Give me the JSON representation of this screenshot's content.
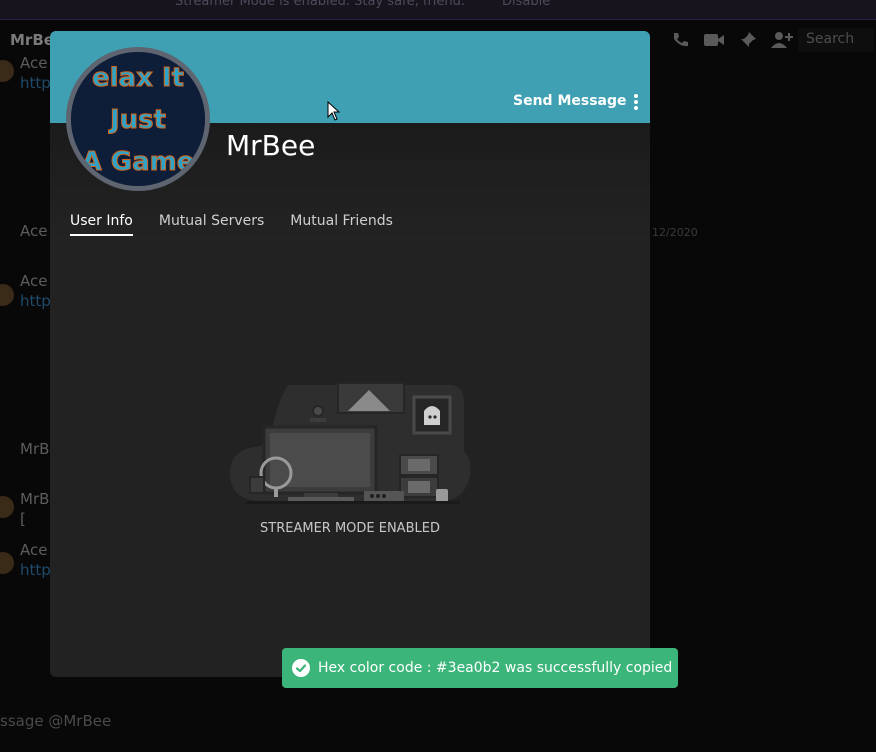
{
  "background": {
    "streamer_notice": "Streamer Mode is enabled. Stay safe, friend.",
    "disable_label": "Disable",
    "channel_name": "MrBe",
    "search_placeholder": "Search",
    "messages": [
      {
        "author": "Ace",
        "text": "http"
      },
      {
        "author": "Ace",
        "text": ""
      },
      {
        "author": "Ace",
        "text": "http"
      },
      {
        "author": "MrB",
        "text": ""
      },
      {
        "author": "MrB",
        "text": "["
      },
      {
        "author": "Ace",
        "text": "http"
      }
    ],
    "date_fragment": "12/2020",
    "input_placeholder": "ssage @MrBee"
  },
  "profile": {
    "username": "MrBee",
    "send_message_label": "Send Message",
    "banner_color": "#3ea0b2",
    "avatar_text": [
      "elax It",
      "Just",
      "A Game"
    ],
    "tabs": [
      {
        "label": "User Info",
        "active": true
      },
      {
        "label": "Mutual Servers",
        "active": false
      },
      {
        "label": "Mutual Friends",
        "active": false
      }
    ],
    "streamer_mode_label": "STREAMER MODE ENABLED"
  },
  "toast": {
    "message": "Hex color code : #3ea0b2 was successfully copied",
    "color": "#3cb57a"
  }
}
